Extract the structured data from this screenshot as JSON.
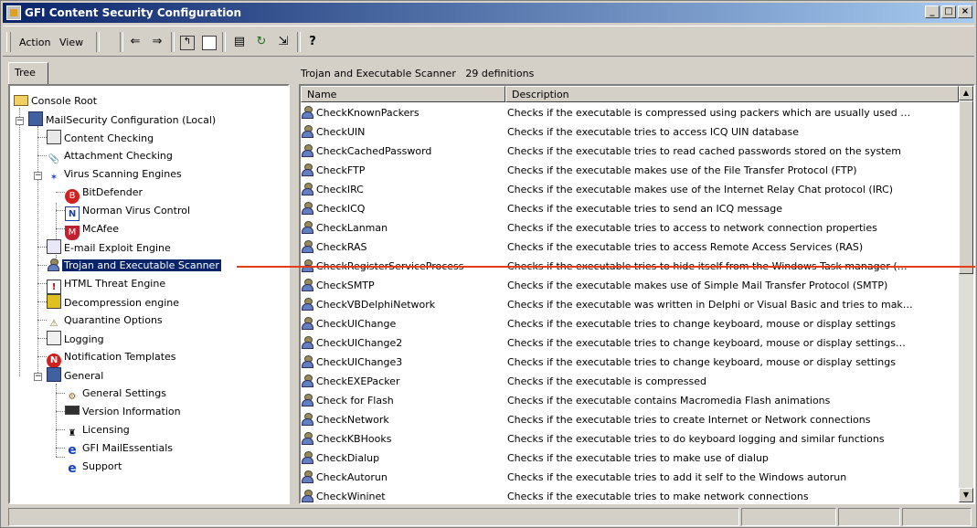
{
  "window": {
    "title": "GFI Content Security Configuration",
    "buttons": [
      "_",
      "□",
      "×"
    ]
  },
  "menu": {
    "action_label": "Action",
    "view_label": "View"
  },
  "toolbar": {
    "icons": [
      "back-icon",
      "forward-icon",
      "up-folder-icon",
      "show-hide-tree-icon",
      "properties-icon",
      "refresh-icon",
      "export-list-icon",
      "help-icon"
    ]
  },
  "tree": {
    "tab_label": "Tree",
    "nodes": [
      {
        "label": "Console Root",
        "icon": "folder-icon"
      },
      {
        "label": "MailSecurity Configuration (Local)",
        "icon": "mailsecurity-icon"
      },
      {
        "label": "Content Checking",
        "icon": "content-checking-icon"
      },
      {
        "label": "Attachment Checking",
        "icon": "paperclip-icon"
      },
      {
        "label": "Virus Scanning Engines",
        "icon": "virus-engines-icon"
      },
      {
        "label": "BitDefender",
        "icon": "bitdefender-icon"
      },
      {
        "label": "Norman Virus Control",
        "icon": "norman-icon"
      },
      {
        "label": "McAfee",
        "icon": "mcafee-icon"
      },
      {
        "label": "E-mail Exploit Engine",
        "icon": "exploit-engine-icon"
      },
      {
        "label": "Trojan and Executable Scanner",
        "icon": "trojan-scanner-icon",
        "selected": true
      },
      {
        "label": "HTML Threat Engine",
        "icon": "html-threat-icon"
      },
      {
        "label": "Decompression engine",
        "icon": "decompression-icon"
      },
      {
        "label": "Quarantine Options",
        "icon": "quarantine-icon"
      },
      {
        "label": "Logging",
        "icon": "logging-icon"
      },
      {
        "label": "Notification Templates",
        "icon": "notification-icon"
      },
      {
        "label": "General",
        "icon": "general-icon"
      },
      {
        "label": "General Settings",
        "icon": "general-settings-icon"
      },
      {
        "label": "Version Information",
        "icon": "version-info-icon"
      },
      {
        "label": "Licensing",
        "icon": "licensing-icon"
      },
      {
        "label": "GFI MailEssentials",
        "icon": "ie-icon"
      },
      {
        "label": "Support",
        "icon": "ie-icon"
      }
    ]
  },
  "list": {
    "header_title": "Trojan and Executable Scanner",
    "header_count": "29 definitions",
    "columns": [
      "Name",
      "Description"
    ],
    "rows": [
      {
        "name": "CheckKnownPackers",
        "desc": "Checks if the executable is compressed using packers which are usually used …"
      },
      {
        "name": "CheckUIN",
        "desc": "Checks if the executable tries to access ICQ UIN database"
      },
      {
        "name": "CheckCachedPassword",
        "desc": "Checks if the executable tries to read cached passwords stored on the system"
      },
      {
        "name": "CheckFTP",
        "desc": "Checks if the executable makes use of the File Transfer Protocol (FTP)"
      },
      {
        "name": "CheckIRC",
        "desc": "Checks if the executable makes use of the Internet Relay Chat protocol (IRC)"
      },
      {
        "name": "CheckICQ",
        "desc": "Checks if the executable tries to send an ICQ message"
      },
      {
        "name": "CheckLanman",
        "desc": "Checks if the executable tries to access to network connection properties"
      },
      {
        "name": "CheckRAS",
        "desc": "Checks if the executable tries to access Remote Access Services (RAS)"
      },
      {
        "name": "CheckRegisterServiceProcess",
        "desc": "Checks if the executable tries to hide itself from the Windows Task manager (…"
      },
      {
        "name": "CheckSMTP",
        "desc": "Checks if the executable makes use of Simple Mail Transfer Protocol (SMTP)"
      },
      {
        "name": "CheckVBDelphiNetwork",
        "desc": "Checks if the executable was written in Delphi or Visual Basic and tries to mak…"
      },
      {
        "name": "CheckUIChange",
        "desc": "Checks if the executable tries to change keyboard, mouse or display settings"
      },
      {
        "name": "CheckUIChange2",
        "desc": "Checks if the executable tries to change keyboard, mouse or display settings…"
      },
      {
        "name": "CheckUIChange3",
        "desc": "Checks if the executable tries to change keyboard, mouse or display settings"
      },
      {
        "name": "CheckEXEPacker",
        "desc": "Checks if the executable is compressed"
      },
      {
        "name": "Check for Flash",
        "desc": "Checks if the executable contains Macromedia Flash animations"
      },
      {
        "name": "CheckNetwork",
        "desc": "Checks if the executable tries to create Internet or Network connections"
      },
      {
        "name": "CheckKBHooks",
        "desc": "Checks if the executable tries to do keyboard logging and similar functions"
      },
      {
        "name": "CheckDialup",
        "desc": "Checks if the executable tries to make use of dialup"
      },
      {
        "name": "CheckAutorun",
        "desc": "Checks if the executable tries to add it self to the Windows autorun"
      },
      {
        "name": "CheckWininet",
        "desc": "Checks if the executable tries to make network connections"
      }
    ]
  },
  "colors": {
    "title_start": "#0a246a",
    "title_end": "#a6caf0",
    "selection": "#0a246a",
    "annotation_line": "#e23e1a"
  }
}
